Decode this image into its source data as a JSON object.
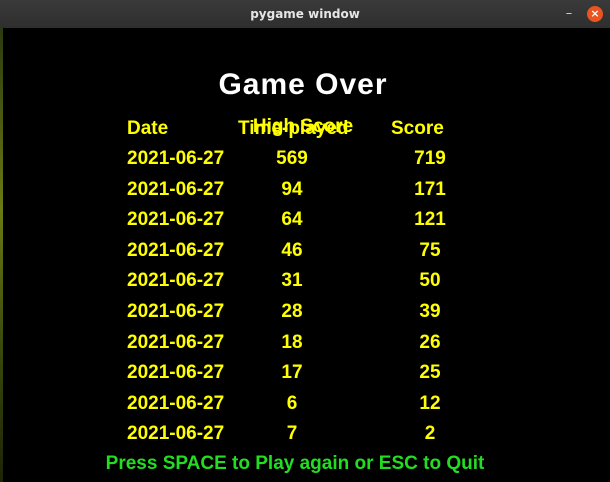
{
  "window": {
    "title": "pygame window",
    "minimize_label": "–",
    "close_label": "×"
  },
  "game": {
    "heading": "Game Over",
    "subheading": "High Score",
    "columns": {
      "date": "Date",
      "time": "Time-played",
      "score": "Score"
    },
    "rows": [
      {
        "date": "2021-06-27",
        "time": "569",
        "score": "719"
      },
      {
        "date": "2021-06-27",
        "time": "94",
        "score": "171"
      },
      {
        "date": "2021-06-27",
        "time": "64",
        "score": "121"
      },
      {
        "date": "2021-06-27",
        "time": "46",
        "score": "75"
      },
      {
        "date": "2021-06-27",
        "time": "31",
        "score": "50"
      },
      {
        "date": "2021-06-27",
        "time": "28",
        "score": "39"
      },
      {
        "date": "2021-06-27",
        "time": "18",
        "score": "26"
      },
      {
        "date": "2021-06-27",
        "time": "17",
        "score": "25"
      },
      {
        "date": "2021-06-27",
        "time": "6",
        "score": "12"
      },
      {
        "date": "2021-06-27",
        "time": "7",
        "score": "2"
      }
    ],
    "footer": "Press SPACE to Play again or ESC to Quit"
  },
  "colors": {
    "heading": "#ffffff",
    "scores": "#ffff00",
    "footer": "#22dd22",
    "background": "#000000",
    "close_button": "#e95420"
  }
}
